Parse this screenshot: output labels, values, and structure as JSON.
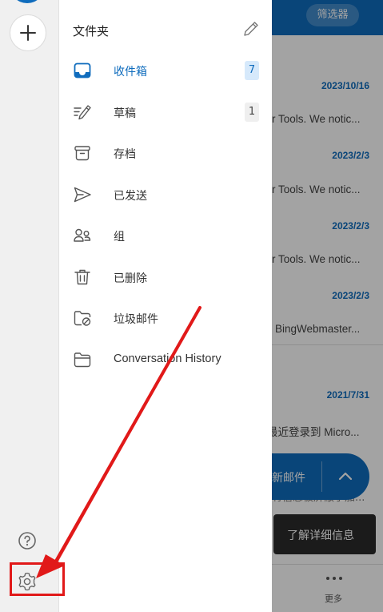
{
  "rail": {
    "icons": {
      "add": "plus-icon",
      "help": "question-circle-icon",
      "settings": "gear-icon"
    }
  },
  "drawer": {
    "title": "文件夹",
    "edit_icon": "pencil-icon",
    "folders": [
      {
        "label": "收件箱",
        "count": "7",
        "icon": "inbox-icon",
        "active": true
      },
      {
        "label": "草稿",
        "count": "1",
        "icon": "drafts-icon"
      },
      {
        "label": "存档",
        "icon": "archive-icon"
      },
      {
        "label": "已发送",
        "icon": "send-icon"
      },
      {
        "label": "组",
        "icon": "group-icon"
      },
      {
        "label": "已删除",
        "icon": "trash-icon"
      },
      {
        "label": "垃圾邮件",
        "icon": "junk-folder-icon"
      },
      {
        "label": "Conversation History",
        "icon": "folder-icon"
      }
    ]
  },
  "background": {
    "filter_label": "筛选器",
    "messages": [
      {
        "date": "2023/10/16",
        "snippet": "r Tools. We notic..."
      },
      {
        "date": "2023/2/3",
        "snippet": "r Tools. We notic..."
      },
      {
        "date": "2023/2/3",
        "snippet": "r Tools. We notic..."
      },
      {
        "date": "2023/2/3",
        "snippet": "BingWebmaster..."
      },
      {
        "date": "2021/7/31",
        "snippet": "最近登录到 Micro..."
      }
    ],
    "fab_label": "新邮件",
    "fab_faint": "有信息被屏蔽了加...",
    "toast_label": "了解详细信息",
    "more_label": "更多"
  },
  "colors": {
    "accent": "#0f6cbd",
    "annotation": "#e11919"
  }
}
